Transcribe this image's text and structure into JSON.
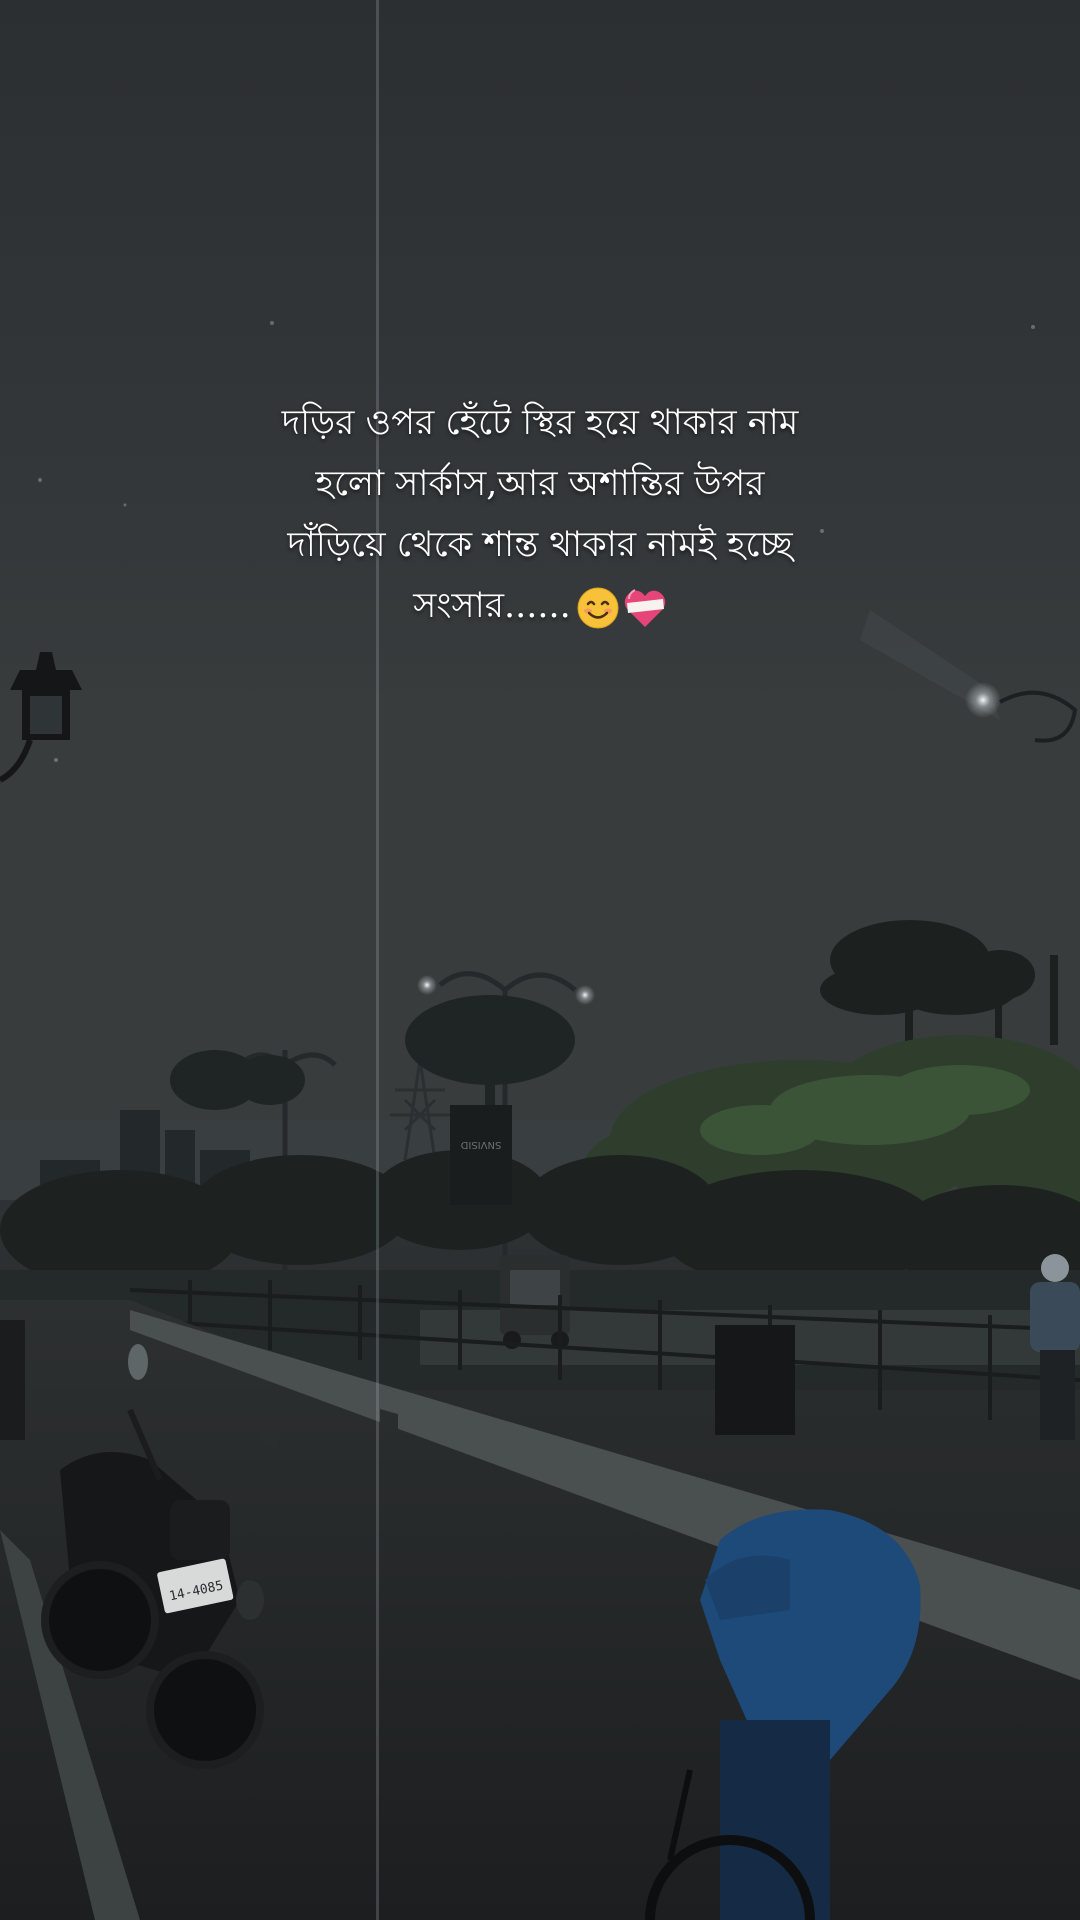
{
  "caption": {
    "lines": [
      "দড়ির ওপর হেঁটে স্থির হয়ে থাকার নাম",
      "হলো সার্কাস,আর অশান্তির উপর",
      "দাঁড়িয়ে থেকে শান্ত থাকার নামই হচ্ছে",
      "সংসার......"
    ],
    "emojis": [
      "smiling-face-icon",
      "mending-heart-icon"
    ]
  },
  "scene": {
    "sign_text": "SNVISID",
    "license_plate": "14-4085"
  },
  "colors": {
    "sky": "#303436",
    "text": "#ffffff",
    "foliage": "#3f5a3a",
    "jacket": "#1e4a7a"
  }
}
